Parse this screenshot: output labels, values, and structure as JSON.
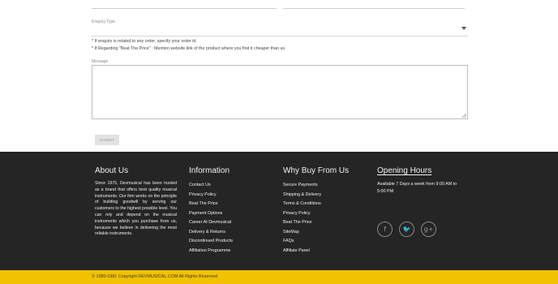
{
  "form": {
    "enquiry_type_label": "Enquiry Type",
    "enquiry_type_value": "",
    "notes": [
      "* If enquiry is related to any order, specify your order id.",
      "* If Regarding \"Beat The Price\" : Mention website link of the product where you find it cheaper than us."
    ],
    "message_label": "Message",
    "message_value": "",
    "submit_label": "SUBMIT"
  },
  "footer": {
    "about": {
      "title": "About Us",
      "text": "Since 1975, Devmusical has been trusted as a brand that offers best quality musical instruments. Our firm works on the principle of building goodwill by serving our customers to the highest possible level. You can rely and depend on the musical instruments which you purchase from us, because we believe in delivering the most reliable instruments."
    },
    "information": {
      "title": "Information",
      "links": [
        "Contact Us",
        "Privacy Policy",
        "Beat The Price",
        "Payment Options",
        "Career At Devmusical",
        "Delivery & Returns",
        "Discontinued Products",
        "Affiliation Programme"
      ]
    },
    "why_buy": {
      "title": "Why Buy From Us",
      "links": [
        "Secure Payments",
        "Shipping & Delivery",
        "Terms & Conditions",
        "Privacy Policy",
        "Beat The Price",
        "SiteMap",
        "FAQs",
        "Affiliate Panel"
      ]
    },
    "hours": {
      "title": "Opening Hours",
      "text": "Available 7 Days a week from 9:00 AM to 5:00 PM"
    },
    "social": [
      {
        "icon": "facebook-icon",
        "glyph": "f"
      },
      {
        "icon": "twitter-icon",
        "glyph": "🐦"
      },
      {
        "icon": "google-plus-icon",
        "glyph": "g+"
      }
    ]
  },
  "copyright": "© 1980-1981 Copyright DEVMUSICAL.COM All Rights Reserved",
  "colors": {
    "footer_bg": "#252525",
    "copyright_bg": "#f2c200"
  }
}
